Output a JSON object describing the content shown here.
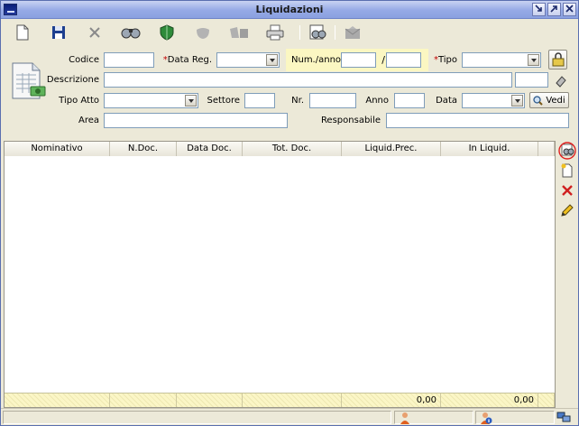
{
  "window": {
    "title": "Liquidazioni"
  },
  "toolbar": {
    "items": [
      {
        "icon": "new-document-icon",
        "enabled": true
      },
      {
        "icon": "save-icon",
        "enabled": true
      },
      {
        "icon": "delete-x-icon",
        "enabled": false
      },
      {
        "icon": "binoculars-search-icon",
        "enabled": true
      },
      {
        "icon": "shield-icon",
        "enabled": true
      },
      {
        "icon": "shield-disabled-icon",
        "enabled": false
      },
      {
        "icon": "copy-icon",
        "enabled": false
      },
      {
        "icon": "print-icon",
        "enabled": true
      },
      {
        "icon": "preview-search-icon",
        "enabled": true
      },
      {
        "icon": "envelope-icon",
        "enabled": false
      }
    ]
  },
  "form": {
    "codice_label": "Codice",
    "data_reg_label": "Data Reg.",
    "num_anno_label": "Num./anno",
    "slash": "/",
    "tipo_label": "Tipo",
    "descrizione_label": "Descrizione",
    "tipo_atto_label": "Tipo Atto",
    "settore_label": "Settore",
    "nr_label": "Nr.",
    "anno_label": "Anno",
    "data_label": "Data",
    "vedi_label": "Vedi",
    "area_label": "Area",
    "responsabile_label": "Responsabile",
    "required_marker": "*",
    "codice_value": "",
    "data_reg_value": "",
    "num_value": "",
    "anno_num_value": "",
    "tipo_value": "",
    "descrizione_value": "",
    "descrizione_extra_value": "",
    "tipo_atto_value": "",
    "settore_value": "",
    "nr_value": "",
    "anno_value": "",
    "data_value": "",
    "area_value": "",
    "responsabile_value": ""
  },
  "grid": {
    "columns": [
      "Nominativo",
      "N.Doc.",
      "Data Doc.",
      "Tot. Doc.",
      "Liquid.Prec.",
      "In Liquid."
    ],
    "rows": [],
    "totals": [
      "",
      "",
      "",
      "",
      "0,00",
      "0,00"
    ]
  },
  "side_buttons": [
    "preview-search-icon",
    "new-row-icon",
    "delete-row-icon",
    "edit-pencil-icon"
  ],
  "status": {
    "segments": [
      "",
      "",
      ""
    ]
  },
  "colors": {
    "required": "#c00000",
    "num_anno_bg": "#fbf7c2",
    "totals_bg": "#fbf6c6",
    "titlebar": "#95a9e6"
  }
}
